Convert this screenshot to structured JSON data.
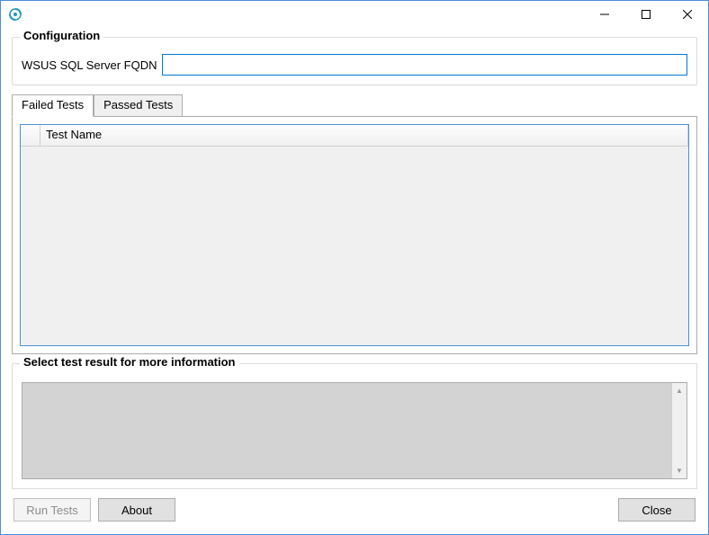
{
  "titlebar": {
    "title": ""
  },
  "configuration": {
    "group_title": "Configuration",
    "fqdn_label": "WSUS SQL Server FQDN",
    "fqdn_value": ""
  },
  "tabs": {
    "failed": "Failed Tests",
    "passed": "Passed Tests"
  },
  "grid": {
    "columns": {
      "test_name": "Test Name"
    }
  },
  "results": {
    "group_title": "Select test result for more information"
  },
  "buttons": {
    "run_tests": "Run Tests",
    "about": "About",
    "close": "Close"
  }
}
